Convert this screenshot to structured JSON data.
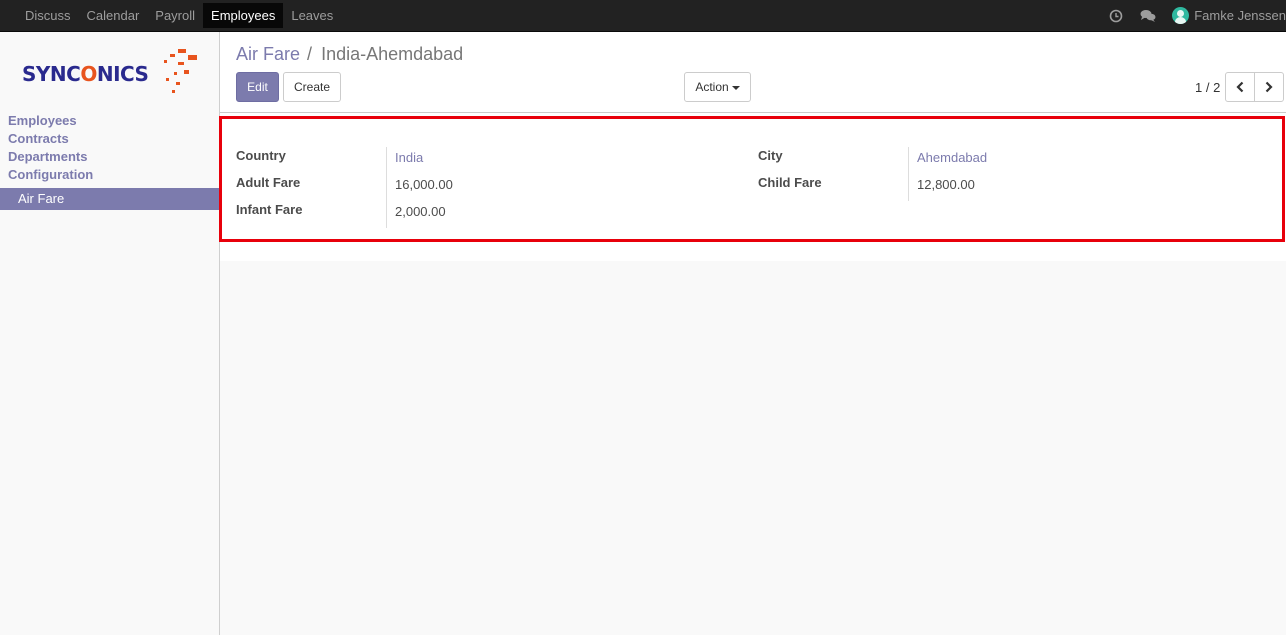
{
  "topbar": {
    "menu": [
      "Discuss",
      "Calendar",
      "Payroll",
      "Employees",
      "Leaves"
    ],
    "active_index": 3,
    "user_name": "Famke Jenssen"
  },
  "logo": {
    "text_pre": "SYNC",
    "text_o": "O",
    "text_post": "NICS"
  },
  "sidebar": {
    "sections": [
      "Employees",
      "Contracts",
      "Departments",
      "Configuration"
    ],
    "active_item": "Air Fare"
  },
  "breadcrumb": {
    "parent": "Air Fare",
    "separator": "/",
    "current": "India-Ahemdabad"
  },
  "toolbar": {
    "edit_label": "Edit",
    "create_label": "Create",
    "action_label": "Action"
  },
  "pager": {
    "text": "1 / 2"
  },
  "form": {
    "country_label": "Country",
    "country_value": "India",
    "adult_fare_label": "Adult Fare",
    "adult_fare_value": "16,000.00",
    "infant_fare_label": "Infant Fare",
    "infant_fare_value": "2,000.00",
    "city_label": "City",
    "city_value": "Ahemdabad",
    "child_fare_label": "Child Fare",
    "child_fare_value": "12,800.00"
  },
  "colors": {
    "brand": "#7c7bad",
    "highlight": "#e8000b",
    "topbar": "#222222"
  },
  "icons": [
    "clock-icon",
    "chat-icon",
    "user-avatar-icon",
    "chevron-left-icon",
    "chevron-right-icon",
    "caret-down-icon"
  ]
}
